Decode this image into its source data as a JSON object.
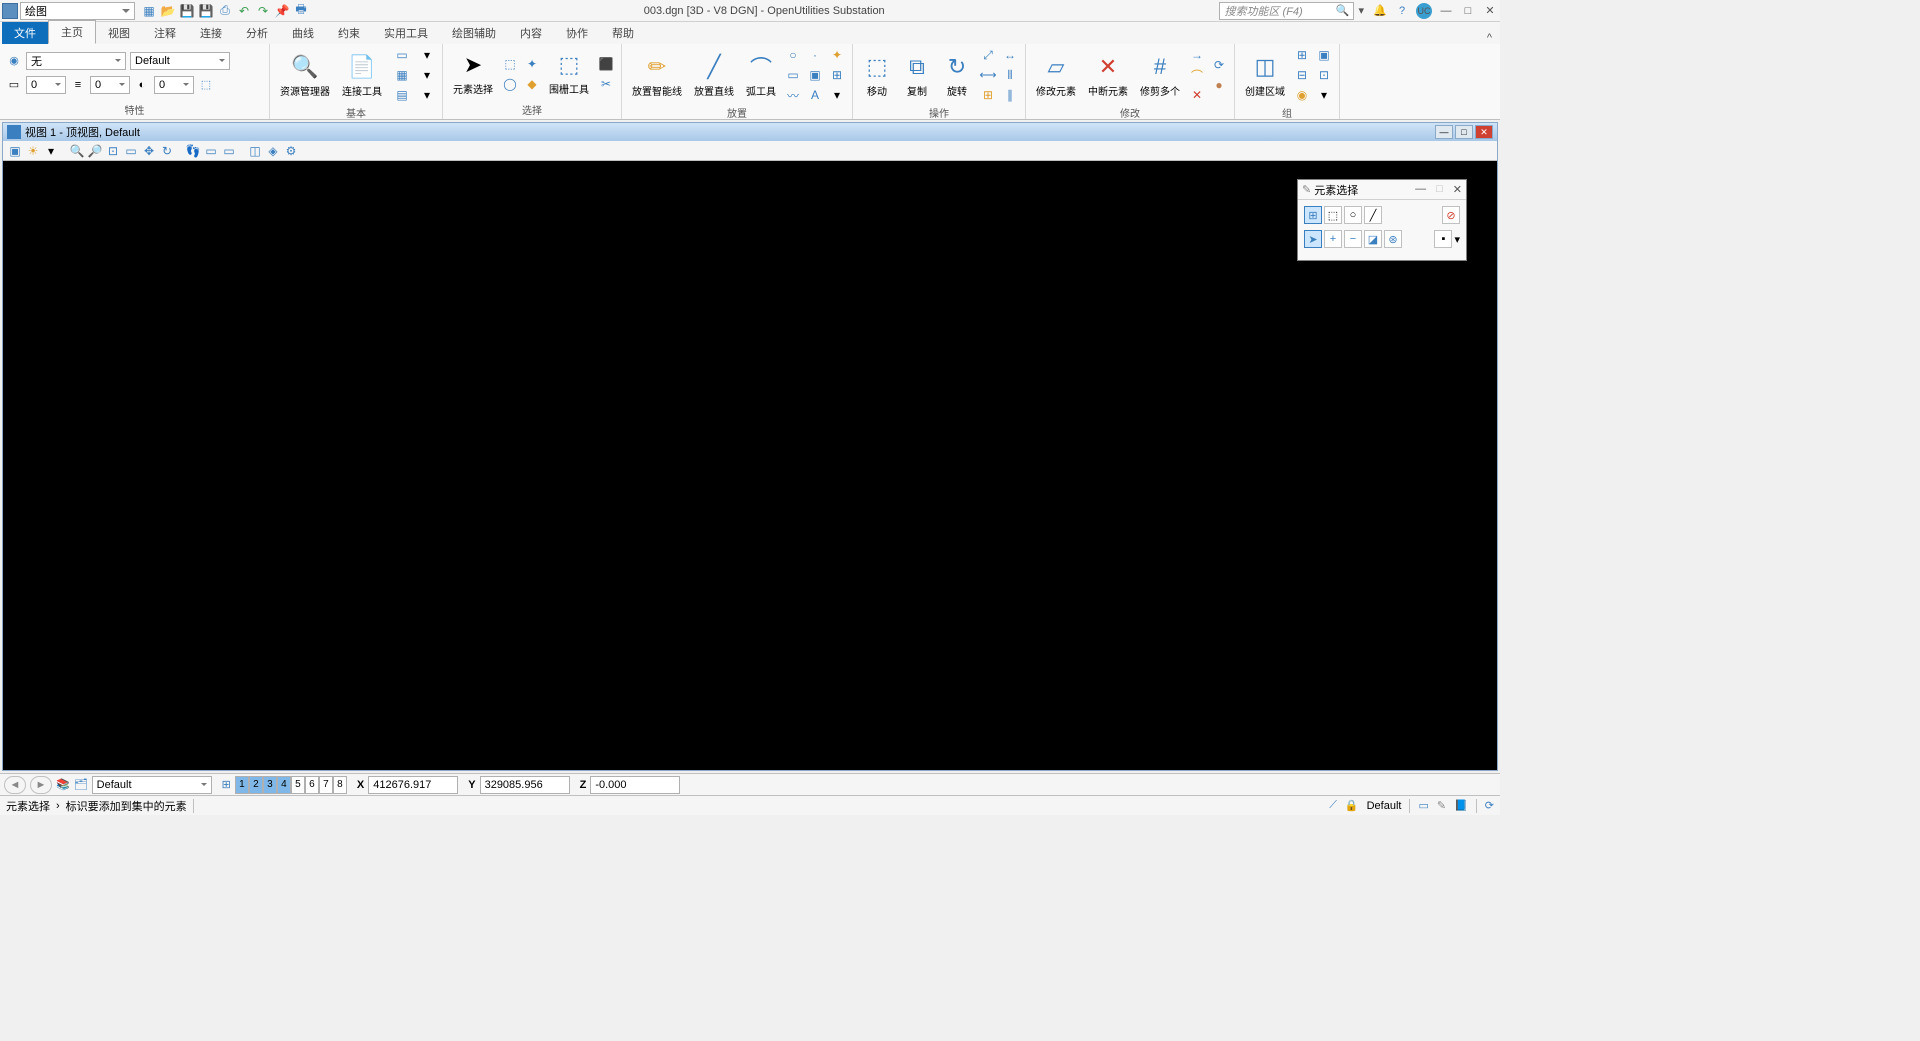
{
  "title": "003.dgn [3D - V8 DGN] - OpenUtilities Substation",
  "workflow": "绘图",
  "search_placeholder": "搜索功能区 (F4)",
  "user_initials": "UC",
  "tabs": {
    "file": "文件",
    "items": [
      "主页",
      "视图",
      "注释",
      "连接",
      "分析",
      "曲线",
      "约束",
      "实用工具",
      "绘图辅助",
      "内容",
      "协作",
      "帮助"
    ],
    "active_index": 0
  },
  "ribbon": {
    "properties": {
      "label": "特性",
      "level": "无",
      "style": "Default",
      "color": "0",
      "line": "0",
      "weight": "0"
    },
    "basic": {
      "label": "基本",
      "explorer": "资源管理器",
      "attach": "连接工具"
    },
    "selection": {
      "label": "选择",
      "elem_select": "元素选择",
      "fence": "围栅工具"
    },
    "placement": {
      "label": "放置",
      "smart_line": "放置智能线",
      "line": "放置直线",
      "arc": "弧工具"
    },
    "manipulate": {
      "label": "操作",
      "move": "移动",
      "copy": "复制",
      "rotate": "旋转"
    },
    "modify": {
      "label": "修改",
      "modify_elem": "修改元素",
      "break": "中断元素",
      "trim": "修剪多个"
    },
    "group": {
      "label": "组",
      "region": "创建区域"
    }
  },
  "view_window": {
    "title": "视图 1 - 顶视图, Default"
  },
  "float_panel": {
    "title": "元素选择"
  },
  "accudraw": {
    "level": "Default",
    "view_tabs": [
      "1",
      "2",
      "3",
      "4",
      "5",
      "6",
      "7",
      "8"
    ],
    "x": "412676.917",
    "y": "329085.956",
    "z": "-0.000"
  },
  "status": {
    "tool": "元素选择",
    "prompt": "标识要添加到集中的元素",
    "level": "Default"
  }
}
